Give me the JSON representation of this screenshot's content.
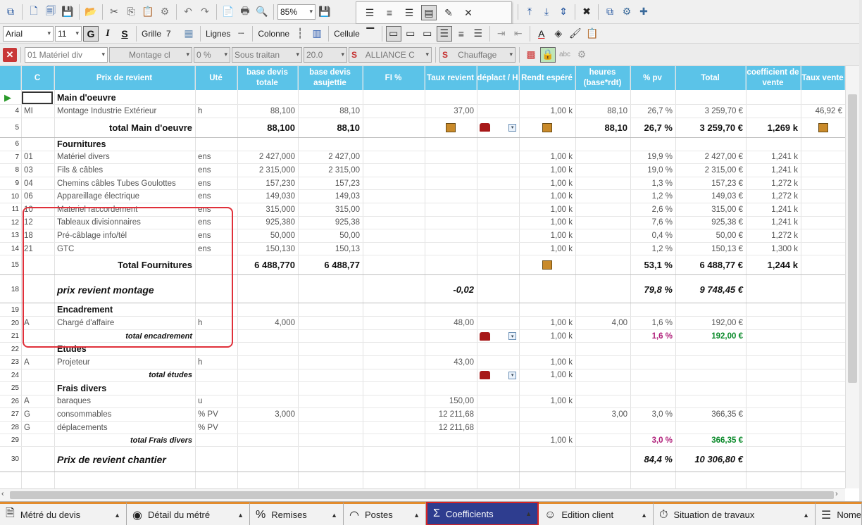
{
  "toolbar1": {
    "zoom": "85%"
  },
  "toolbar2": {
    "font": "Arial",
    "size": "11",
    "bold": "G",
    "italic": "I",
    "underline": "S",
    "grid_label": "Grille",
    "grid_value": "7",
    "lines_label": "Lignes",
    "columns_label": "Colonne",
    "cell_label": "Cellule"
  },
  "toolbar3": {
    "combo1": "01 Matériel div",
    "combo2": "Montage cl",
    "combo3": "0 %",
    "combo4": "Sous traitan",
    "combo5": "20.0",
    "combo6": "ALLIANCE C",
    "combo7": "Chauffage"
  },
  "headers": [
    {
      "label": "C",
      "w": 0
    },
    {
      "label": "Prix de revient"
    },
    {
      "label": "Uté"
    },
    {
      "label": "base devis totale"
    },
    {
      "label": "base devis asujettie"
    },
    {
      "label": "FI %"
    },
    {
      "label": "Taux revient"
    },
    {
      "label": "déplact / H"
    },
    {
      "label": "Rendt espéré"
    },
    {
      "label": "heures (base*rdt)"
    },
    {
      "label": "% pv"
    },
    {
      "label": "Total"
    },
    {
      "label": "coefficient de vente"
    },
    {
      "label": "Taux vente"
    }
  ],
  "rows": [
    {
      "n": "",
      "c": "",
      "label": "Main d'oeuvre",
      "type": "section"
    },
    {
      "n": "4",
      "c": "MI",
      "label": "Montage Industrie Extérieur",
      "ute": "h",
      "bdt": "88,100",
      "bda": "88,10",
      "taux": "37,00",
      "rendt": "1,00 k",
      "heures": "88,10",
      "pv": "26,7 %",
      "total": "3 259,70 €",
      "coef": "",
      "tv": "46,92 €"
    },
    {
      "n": "5",
      "label": "total Main d'oeuvre",
      "bdt": "88,100",
      "bda": "88,10",
      "heures": "88,10",
      "pv": "26,7 %",
      "total": "3 259,70 €",
      "coef": "1,269 k",
      "type": "total"
    },
    {
      "n": "6",
      "label": "Fournitures",
      "type": "section"
    },
    {
      "n": "7",
      "c": "01",
      "label": "Matériel divers",
      "ute": "ens",
      "bdt": "2 427,000",
      "bda": "2 427,00",
      "rendt": "1,00 k",
      "pv": "19,9 %",
      "total": "2 427,00 €",
      "coef": "1,241 k"
    },
    {
      "n": "8",
      "c": "03",
      "label": "Fils & câbles",
      "ute": "ens",
      "bdt": "2 315,000",
      "bda": "2 315,00",
      "rendt": "1,00 k",
      "pv": "19,0 %",
      "total": "2 315,00 €",
      "coef": "1,241 k"
    },
    {
      "n": "9",
      "c": "04",
      "label": "Chemins câbles Tubes Goulottes",
      "ute": "ens",
      "bdt": "157,230",
      "bda": "157,23",
      "rendt": "1,00 k",
      "pv": "1,3 %",
      "total": "157,23 €",
      "coef": "1,272 k"
    },
    {
      "n": "10",
      "c": "06",
      "label": "Appareillage électrique",
      "ute": "ens",
      "bdt": "149,030",
      "bda": "149,03",
      "rendt": "1,00 k",
      "pv": "1,2 %",
      "total": "149,03 €",
      "coef": "1,272 k"
    },
    {
      "n": "11",
      "c": "10",
      "label": "Materiel raccordement",
      "ute": "ens",
      "bdt": "315,000",
      "bda": "315,00",
      "rendt": "1,00 k",
      "pv": "2,6 %",
      "total": "315,00 €",
      "coef": "1,241 k"
    },
    {
      "n": "12",
      "c": "12",
      "label": "Tableaux divisionnaires",
      "ute": "ens",
      "bdt": "925,380",
      "bda": "925,38",
      "rendt": "1,00 k",
      "pv": "7,6 %",
      "total": "925,38 €",
      "coef": "1,241 k"
    },
    {
      "n": "13",
      "c": "18",
      "label": "Pré-câblage info/tél",
      "ute": "ens",
      "bdt": "50,000",
      "bda": "50,00",
      "rendt": "1,00 k",
      "pv": "0,4 %",
      "total": "50,00 €",
      "coef": "1,272 k"
    },
    {
      "n": "14",
      "c": "21",
      "label": "GTC",
      "ute": "ens",
      "bdt": "150,130",
      "bda": "150,13",
      "rendt": "1,00 k",
      "pv": "1,2 %",
      "total": "150,13 €",
      "coef": "1,300 k"
    },
    {
      "n": "15",
      "label": "Total Fournitures",
      "bdt": "6 488,770",
      "bda": "6 488,77",
      "pv": "53,1 %",
      "total": "6 488,77 €",
      "coef": "1,244 k",
      "type": "total"
    },
    {
      "n": "18",
      "label": "prix revient montage",
      "taux": "-0,02",
      "pv": "79,8 %",
      "total": "9 748,45 €",
      "type": "grand"
    },
    {
      "n": "19",
      "label": "Encadrement",
      "type": "section"
    },
    {
      "n": "20",
      "c": "A",
      "label": "Chargé d'affaire",
      "ute": "h",
      "bdt": "4,000",
      "taux": "48,00",
      "rendt": "1,00 k",
      "heures": "4,00",
      "pv": "1,6 %",
      "total": "192,00 €"
    },
    {
      "n": "21",
      "label": "total encadrement",
      "rendt": "1,00 k",
      "pv": "1,6 %",
      "total": "192,00 €",
      "type": "subtotal"
    },
    {
      "n": "22",
      "label": "Etudes",
      "type": "section"
    },
    {
      "n": "23",
      "c": "A",
      "label": "Projeteur",
      "ute": "h",
      "taux": "43,00",
      "rendt": "1,00 k"
    },
    {
      "n": "24",
      "label": "total études",
      "rendt": "1,00 k",
      "type": "subtotal"
    },
    {
      "n": "25",
      "label": "Frais divers",
      "type": "section"
    },
    {
      "n": "26",
      "c": "A",
      "label": "baraques",
      "ute": "u",
      "taux": "150,00",
      "rendt": "1,00 k"
    },
    {
      "n": "27",
      "c": "G",
      "label": "consommables",
      "ute": "% PV",
      "bdt": "3,000",
      "taux": "12 211,68",
      "heures": "3,00",
      "pv": "3,0 %",
      "total": "366,35 €"
    },
    {
      "n": "28",
      "c": "G",
      "label": "déplacements",
      "ute": "% PV",
      "taux": "12 211,68"
    },
    {
      "n": "29",
      "label": "total Frais divers",
      "rendt": "1,00 k",
      "pv": "3,0 %",
      "total": "366,35 €",
      "type": "subtotal"
    },
    {
      "n": "30",
      "label": "Prix de revient chantier",
      "pv": "84,4 %",
      "total": "10 306,80 €",
      "type": "grand"
    }
  ],
  "tabs": [
    {
      "label": "Métré du devis",
      "icon": "document-icon"
    },
    {
      "label": "Détail du métré",
      "icon": "eye-icon"
    },
    {
      "label": "Remises",
      "icon": "percent-icon"
    },
    {
      "label": "Postes",
      "icon": "gauge-icon"
    },
    {
      "label": "Coefficients",
      "icon": "sigma-icon",
      "active": true
    },
    {
      "label": "Edition client",
      "icon": "user-icon"
    },
    {
      "label": "Situation de travaux",
      "icon": "timer-icon"
    },
    {
      "label": "Nome",
      "icon": "list-icon"
    }
  ]
}
